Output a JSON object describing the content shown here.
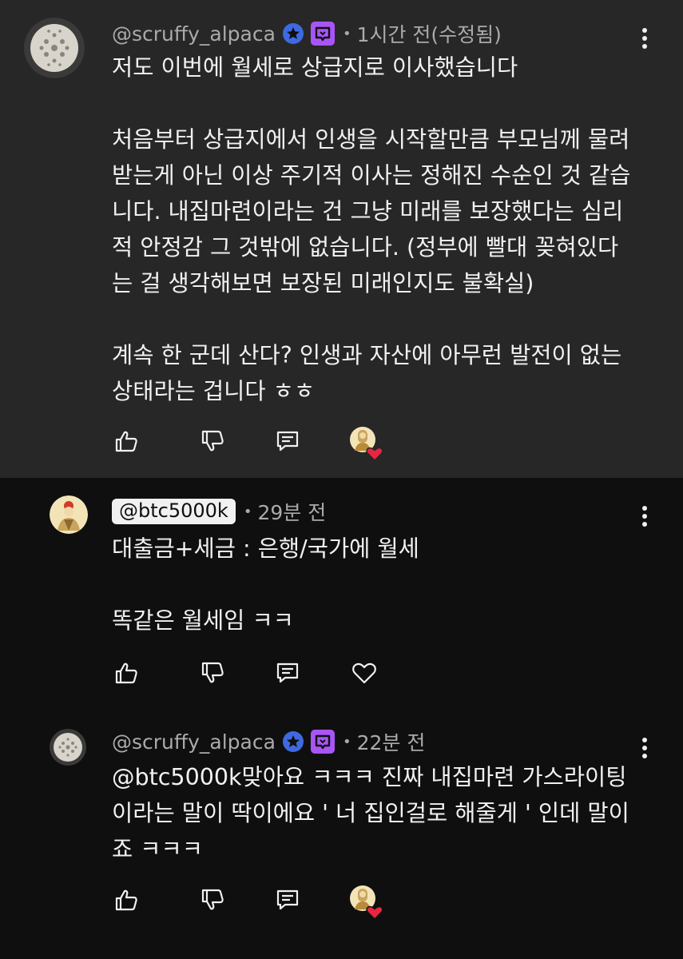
{
  "comments": [
    {
      "handle": "@scruffy_alpaca",
      "timestamp": "1시간 전(수정됨)",
      "body": "저도 이번에 월세로 상급지로 이사했습니다\n\n처음부터 상급지에서 인생을 시작할만큼 부모님께 물려\n받는게 아닌 이상 주기적 이사는 정해진 수순인 것 같습\n니다. 내집마련이라는 건 그냥 미래를 보장했다는 심리\n적 안정감 그 것밖에 없습니다. (정부에 빨대 꽂혀있다\n는 걸 생각해보면 보장된 미래인지도 불확실)\n\n계속 한 군데 산다? 인생과 자산에 아무런 발전이 없는\n상태라는 겁니다 ㅎㅎ",
      "badges": [
        "verified-star-icon",
        "member-badge-icon"
      ],
      "creator_hearted": true
    },
    {
      "handle": "@btc5000k",
      "timestamp": "29분 전",
      "body": "대출금+세금 : 은행/국가에 월세\n\n똑같은 월세임 ㅋㅋ",
      "badges": [],
      "creator_hearted": false
    },
    {
      "handle": "@scruffy_alpaca",
      "timestamp": "22분 전",
      "body": "@btc5000k맞아요 ㅋㅋㅋ 진짜 내집마련 가스라이팅\n이라는 말이 딱이에요 ' 너 집인걸로 해줄게 ' 인데 말이\n죠 ㅋㅋㅋ",
      "badges": [
        "verified-star-icon",
        "member-badge-icon"
      ],
      "creator_hearted": true
    }
  ],
  "separator": "•",
  "colors": {
    "background": "#0f0f0f",
    "highlighted_background": "#272727",
    "text": "#f1f1f1",
    "meta_text": "#aaaaaa",
    "badge_blue": "#3e6ae1",
    "badge_purple": "#a855f7",
    "heart_red": "#e8263f"
  }
}
